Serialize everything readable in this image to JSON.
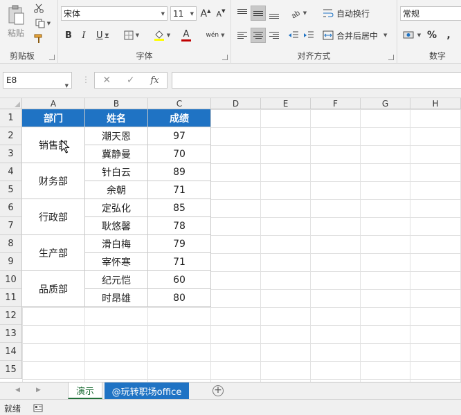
{
  "ribbon": {
    "clipboard": {
      "label": "剪贴板",
      "paste": "粘贴"
    },
    "font": {
      "label": "字体",
      "font_name": "宋体",
      "font_size": "11",
      "grow": "A",
      "shrink": "A",
      "bold": "B",
      "italic": "I",
      "underline": "U",
      "font_color_glyph": "A",
      "phonetic": "wén"
    },
    "alignment": {
      "label": "对齐方式",
      "wrap_text": "自动换行",
      "merge_center": "合并后居中"
    },
    "number": {
      "label": "数字",
      "format": "常规",
      "percent": "%"
    }
  },
  "formula_bar": {
    "name_box": "E8",
    "fx": "fx",
    "value": ""
  },
  "columns": [
    "A",
    "B",
    "C",
    "D",
    "E",
    "F",
    "G",
    "H"
  ],
  "rows": [
    "1",
    "2",
    "3",
    "4",
    "5",
    "6",
    "7",
    "8",
    "9",
    "10",
    "11",
    "12",
    "13",
    "14",
    "15"
  ],
  "table": {
    "headers": [
      "部门",
      "姓名",
      "成绩"
    ],
    "departments": [
      "销售部",
      "财务部",
      "行政部",
      "生产部",
      "品质部"
    ],
    "names": [
      "潮天恩",
      "冀静曼",
      "针白云",
      "余朝",
      "定弘化",
      "耿悠馨",
      "滑白梅",
      "宰怀寒",
      "纪元恺",
      "时昂雄"
    ],
    "scores": [
      "97",
      "70",
      "89",
      "71",
      "85",
      "78",
      "79",
      "71",
      "60",
      "80"
    ]
  },
  "sheets": [
    "演示",
    "@玩转职场office"
  ],
  "status": {
    "ready": "就绪"
  },
  "colors": {
    "header_blue": "#1f73c4",
    "active_tab_green": "#1f6e37"
  }
}
